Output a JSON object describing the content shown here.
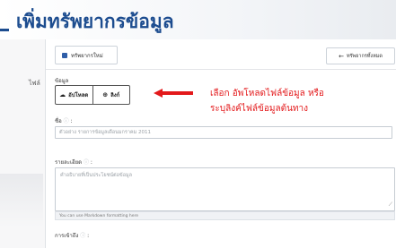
{
  "page": {
    "title": "เพิ่มทรัพยากรข้อมูล"
  },
  "side_nav": {
    "visible_label": "ไฟล์"
  },
  "card_header": {
    "tab_label": "ทรัพยากรใหม่",
    "back_button": "ทรัพยากรทั้งหมด"
  },
  "data_source": {
    "label": "ข้อมูล",
    "upload_label": "อัปโหลด",
    "link_label": "ลิงก์"
  },
  "callout": {
    "line1": "เลือก อัพโหลดไฟล์ข้อมูล หรือ",
    "line2": "ระบุลิงค์ไฟล์ข้อมูลต้นทาง",
    "color": "#e3191b"
  },
  "fields": {
    "name_label": "ชื่อ",
    "name_placeholder": "ตัวอย่าง รายการข้อมูลเดือนมกราคม 2011",
    "description_label": "รายละเอียด",
    "description_placeholder": "คำอธิบายที่เป็นประโยชน์ต่อข้อมูล",
    "markdown_hint": "You can use Markdown formatting here",
    "format_label": "การเข้าถึง"
  },
  "colors": {
    "title": "#1c4c8f",
    "accent": "#e3191b"
  }
}
